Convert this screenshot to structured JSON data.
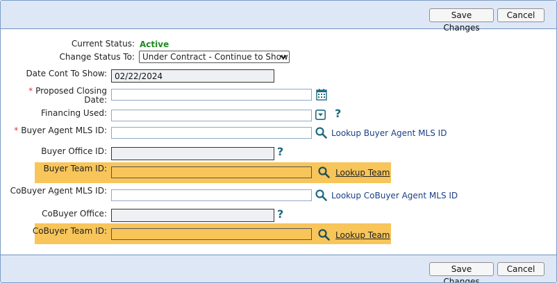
{
  "toolbar": {
    "save_label": "Save Changes",
    "cancel_label": "Cancel"
  },
  "form": {
    "current_status_label": "Current Status:",
    "current_status_value": "Active",
    "change_status_label": "Change Status To:",
    "change_status_value": "Under Contract - Continue to Show",
    "date_cont_label": "Date Cont To Show:",
    "date_cont_value": "02/22/2024",
    "proposed_closing_label_1": "Proposed Closing",
    "proposed_closing_label_2": "Date:",
    "financing_label": "Financing Used:",
    "buyer_agent_label": "Buyer Agent MLS ID:",
    "buyer_agent_lookup": "Lookup Buyer Agent MLS ID",
    "buyer_office_label": "Buyer Office ID:",
    "buyer_team_label": "Buyer Team ID:",
    "buyer_team_lookup": "Lookup Team",
    "cobuyer_agent_label": "CoBuyer Agent MLS ID:",
    "cobuyer_agent_lookup": "Lookup CoBuyer Agent MLS ID",
    "cobuyer_office_label": "CoBuyer Office:",
    "cobuyer_team_label": "CoBuyer Team ID:",
    "cobuyer_team_lookup": "Lookup Team",
    "required_mark": "*",
    "help_mark": "?"
  },
  "colors": {
    "accent": "#1d6a80",
    "status": "#1f8a1f",
    "highlight": "#f7c55a",
    "bar": "#dde7f5"
  },
  "icons": [
    "calendar-icon",
    "dropdown-icon",
    "help-icon",
    "search-icon",
    "chevron-down-icon"
  ]
}
